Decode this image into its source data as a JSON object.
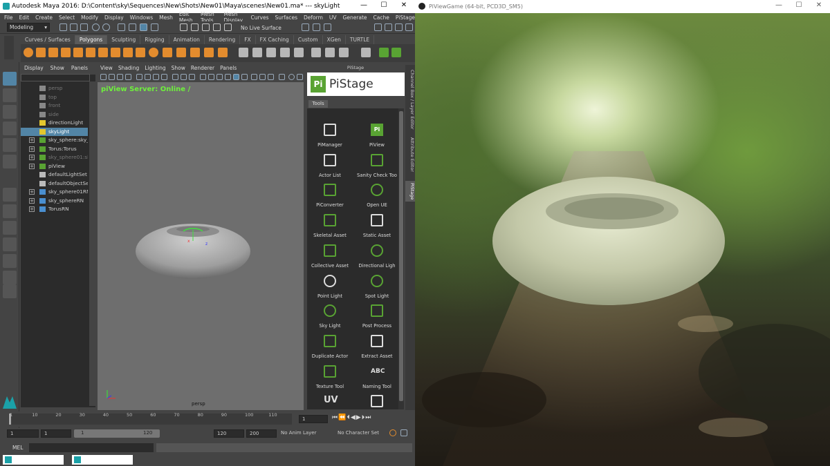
{
  "maya": {
    "title": "Autodesk Maya 2016: D:\\Content\\sky\\Sequences\\New\\Shots\\New01\\Maya\\scenes\\New01.ma*   ---   skyLight",
    "menu": [
      "File",
      "Edit",
      "Create",
      "Select",
      "Modify",
      "Display",
      "Windows",
      "Mesh",
      "Edit Mesh",
      "Mesh Tools",
      "Mesh Display",
      "Curves",
      "Surfaces",
      "Deform",
      "UV",
      "Generate",
      "Cache",
      "PiStage"
    ],
    "mode_select": "Modeling",
    "live_surface": "No Live Surface",
    "shelf_tabs": [
      "Curves / Surfaces",
      "Polygons",
      "Sculpting",
      "Rigging",
      "Animation",
      "Rendering",
      "FX",
      "FX Caching",
      "Custom",
      "XGen",
      "TURTLE"
    ],
    "active_shelf": "Polygons",
    "outliner_menu": [
      "Display",
      "Show",
      "Panels"
    ],
    "outliner_items": [
      {
        "label": "persp",
        "dim": true
      },
      {
        "label": "top",
        "dim": true
      },
      {
        "label": "front",
        "dim": true
      },
      {
        "label": "side",
        "dim": true
      },
      {
        "label": "directionLight",
        "dim": false
      },
      {
        "label": "skyLight",
        "dim": false
      },
      {
        "label": "sky_sphere:sky_sp",
        "dim": false
      },
      {
        "label": "Torus:Torus",
        "dim": false
      },
      {
        "label": "sky_sphere01:sky_",
        "dim": true
      },
      {
        "label": "piView",
        "dim": false
      },
      {
        "label": "defaultLightSet",
        "dim": false
      },
      {
        "label": "defaultObjectSet",
        "dim": false
      },
      {
        "label": "sky_sphere01RN",
        "dim": false
      },
      {
        "label": "sky_sphereRN",
        "dim": false
      },
      {
        "label": "TorusRN",
        "dim": false
      }
    ],
    "viewport_menu": [
      "View",
      "Shading",
      "Lighting",
      "Show",
      "Renderer",
      "Panels"
    ],
    "server_status": "piView Server: Online /",
    "camera_label": "persp",
    "pistage": {
      "header": "PiStage",
      "logo_text": "PiStage",
      "logo_badge": "Pi",
      "tab": "Tools",
      "tools": [
        {
          "label": "PiManager",
          "icon": "pimanager-icon"
        },
        {
          "label": "PiView",
          "icon": "piview-icon"
        },
        {
          "label": "Actor List",
          "icon": "actor-list-icon"
        },
        {
          "label": "Sanity Check Too",
          "icon": "sanity-check-icon"
        },
        {
          "label": "PiConverter",
          "icon": "piconverter-icon"
        },
        {
          "label": "Open UE",
          "icon": "unreal-icon"
        },
        {
          "label": "Skeletal Asset",
          "icon": "skeletal-icon"
        },
        {
          "label": "Static Asset",
          "icon": "static-cube-icon"
        },
        {
          "label": "Collective Asset",
          "icon": "collective-icon"
        },
        {
          "label": "Directional Ligh",
          "icon": "directional-light-icon"
        },
        {
          "label": "Point Light",
          "icon": "point-light-icon"
        },
        {
          "label": "Spot Light",
          "icon": "spot-light-icon"
        },
        {
          "label": "Sky Light",
          "icon": "sky-light-icon"
        },
        {
          "label": "Post Process",
          "icon": "post-process-icon"
        },
        {
          "label": "Duplicate Actor",
          "icon": "duplicate-icon"
        },
        {
          "label": "Extract Asset",
          "icon": "extract-icon"
        },
        {
          "label": "Texture Tool",
          "icon": "texture-icon"
        },
        {
          "label": "Naming Tool",
          "icon": "abc-icon"
        },
        {
          "label": "",
          "icon": "uv-icon"
        },
        {
          "label": "",
          "icon": "clapper-icon"
        }
      ],
      "uv_glyph": "UV",
      "abc_glyph": "ABC",
      "badge_pi": "Pi"
    },
    "side_tabs": [
      "Channel Box / Layer Editor",
      "Attribute Editor",
      "PiStage"
    ],
    "timeline_ticks": [
      "1",
      "10",
      "20",
      "30",
      "40",
      "50",
      "60",
      "70",
      "80",
      "90",
      "100",
      "110"
    ],
    "current_frame": "1",
    "range": {
      "start": "1",
      "inner_start": "1",
      "slider_left": "1",
      "slider_right": "120",
      "inner_end": "120",
      "end": "200"
    },
    "anim_layer": "No Anim Layer",
    "char_set": "No Character Set",
    "mel_label": "MEL"
  },
  "game": {
    "title": "PiViewGame (64-bit, PCD3D_SM5)"
  },
  "colors": {
    "accent_green": "#59a333",
    "server_green": "#6ef03c",
    "select_blue": "#5285a6"
  }
}
